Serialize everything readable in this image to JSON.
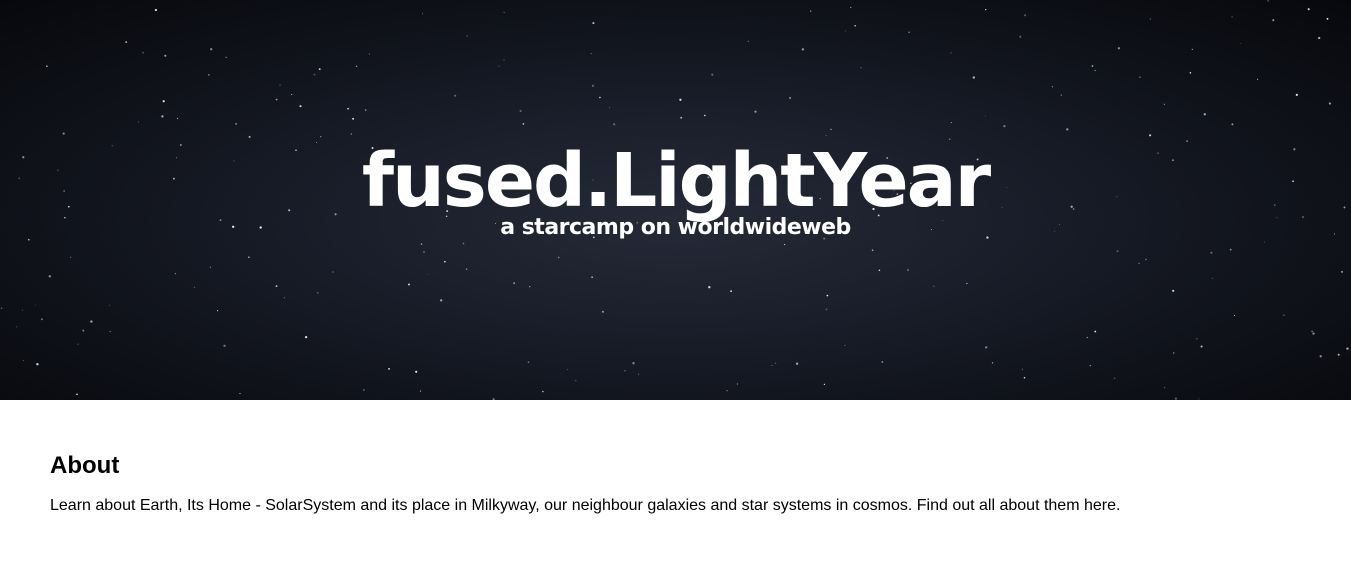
{
  "hero": {
    "title": "fused.LightYear",
    "subtitle": "a starcamp on worldwideweb",
    "background_color": "#10131b",
    "star_color": "#ffffff"
  },
  "about": {
    "heading": "About",
    "text": "Learn about Earth, Its Home - SolarSystem and its place in Milkyway, our neighbour galaxies and star systems in cosmos. Find out all about them here."
  }
}
